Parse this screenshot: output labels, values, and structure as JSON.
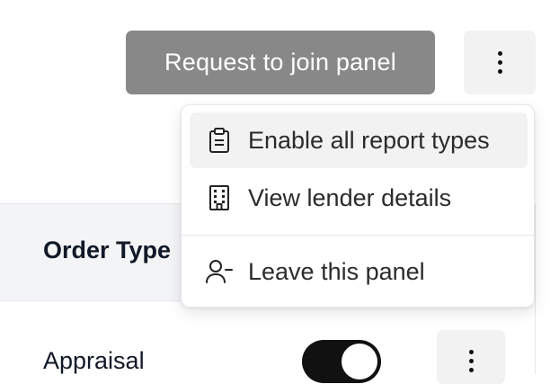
{
  "header": {
    "join_button_label": "Request to join panel",
    "more_icon": "kebab-vertical-icon"
  },
  "menu": {
    "items": [
      {
        "label": "Enable all report types",
        "icon": "clipboard-icon",
        "highlighted": true
      },
      {
        "label": "View lender details",
        "icon": "building-icon"
      },
      {
        "label": "Leave this panel",
        "icon": "user-minus-icon"
      }
    ]
  },
  "table": {
    "columns": [
      "Order Type"
    ],
    "rows": [
      {
        "order_type": "Appraisal",
        "enabled": true
      }
    ]
  },
  "colors": {
    "join_button_bg": "#888888",
    "toggle_on": "#111111",
    "header_bg": "#f3f4f6",
    "menu_highlight": "#f2f2f2"
  }
}
